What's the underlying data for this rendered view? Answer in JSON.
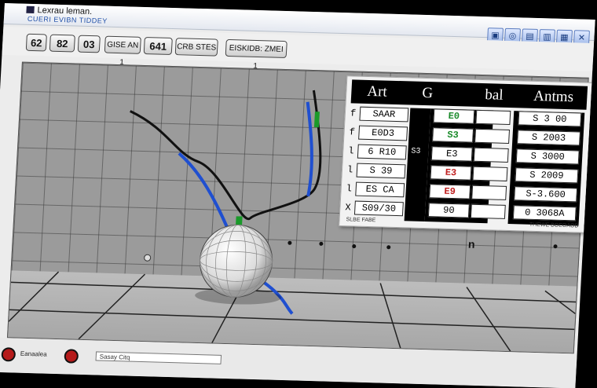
{
  "titlebar": {
    "title": "Lexrau leman.",
    "menu_text": "CUERI EVIBN TIDDEY",
    "sys_icons": [
      "monitor-icon",
      "globe-icon",
      "folder-icon",
      "document-icon",
      "printer-icon",
      "close-icon"
    ]
  },
  "toolbar": {
    "btn_a": "62",
    "btn_b": "82",
    "btn_c": "03",
    "btn_d": "GISE AN 1",
    "btn_e": "641",
    "btn_f": "CRB STES",
    "btn_g": "EISKIDB: ZMEI 1"
  },
  "panel": {
    "headers": [
      "Art",
      "G",
      "bal",
      "Antms"
    ],
    "rows": [
      {
        "tag": "f",
        "name": "SAAR",
        "mid": "",
        "val1": "E0",
        "val2": "",
        "val3": "S 3 00"
      },
      {
        "tag": "f",
        "name": "E0D3",
        "mid": "",
        "val1": "S3",
        "val2": "",
        "val3": "S 2003"
      },
      {
        "tag": "l",
        "name": "6 R10",
        "mid": "S3",
        "val1": "E3",
        "val2": "",
        "val3": "S 3000"
      },
      {
        "tag": "l",
        "name": "S 39",
        "mid": "",
        "val1": "E3",
        "val2": "",
        "val3": "S 2009"
      },
      {
        "tag": "l",
        "name": "ES CA",
        "mid": "",
        "val1": "E9",
        "val2": "",
        "val3": "S-3.600"
      },
      {
        "tag": "X",
        "name": "S09/30",
        "mid": "",
        "val1": "90",
        "val2": "",
        "val3": "0 3068A"
      }
    ],
    "foot_left": "SLBE FABE",
    "foot_right": "THEWE BOEOAOD"
  },
  "wall_label": "n",
  "status": {
    "label_a": "Eanaalea",
    "field_text": "Sasay Citq"
  }
}
